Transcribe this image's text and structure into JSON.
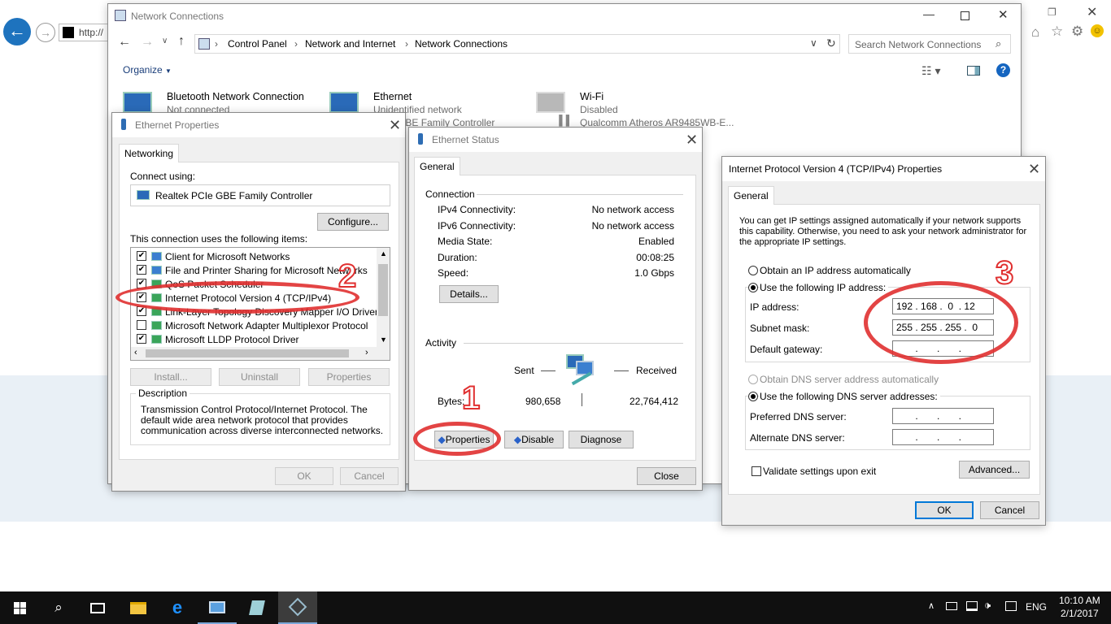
{
  "browser": {
    "url": "http://"
  },
  "netconn": {
    "title": "Network Connections",
    "breadcrumb": [
      "Control Panel",
      "Network and Internet",
      "Network Connections"
    ],
    "search_placeholder": "Search Network Connections",
    "organize": "Organize",
    "adapters": [
      {
        "name": "Bluetooth Network Connection",
        "status": "Not connected",
        "device": ""
      },
      {
        "name": "Ethernet",
        "status": "Unidentified network",
        "device": "PCIe GBE Family Controller"
      },
      {
        "name": "Wi-Fi",
        "status": "Disabled",
        "device": "Qualcomm Atheros AR9485WB-E..."
      }
    ]
  },
  "ethprops": {
    "title": "Ethernet Properties",
    "tab": "Networking",
    "connect_using": "Connect using:",
    "adapter": "Realtek PCIe GBE Family Controller",
    "configure": "Configure...",
    "items_label": "This connection uses the following items:",
    "items": [
      {
        "label": "Client for Microsoft Networks",
        "checked": true
      },
      {
        "label": "File and Printer Sharing for Microsoft Networks",
        "checked": true
      },
      {
        "label": "QoS Packet Scheduler",
        "checked": true
      },
      {
        "label": "Internet Protocol Version 4 (TCP/IPv4)",
        "checked": true
      },
      {
        "label": "Link-Layer Topology Discovery Mapper I/O Driver",
        "checked": true
      },
      {
        "label": "Microsoft Network Adapter Multiplexor Protocol",
        "checked": false
      },
      {
        "label": "Microsoft LLDP Protocol Driver",
        "checked": true
      }
    ],
    "install": "Install...",
    "uninstall": "Uninstall",
    "properties": "Properties",
    "description_label": "Description",
    "description": "Transmission Control Protocol/Internet Protocol. The default wide area network protocol that provides communication across diverse interconnected networks.",
    "ok": "OK",
    "cancel": "Cancel"
  },
  "ethstatus": {
    "title": "Ethernet Status",
    "tab": "General",
    "connection_label": "Connection",
    "rows": [
      {
        "label": "IPv4 Connectivity:",
        "value": "No network access"
      },
      {
        "label": "IPv6 Connectivity:",
        "value": "No network access"
      },
      {
        "label": "Media State:",
        "value": "Enabled"
      },
      {
        "label": "Duration:",
        "value": "00:08:25"
      },
      {
        "label": "Speed:",
        "value": "1.0 Gbps"
      }
    ],
    "details": "Details...",
    "activity_label": "Activity",
    "sent": "Sent",
    "received": "Received",
    "bytes_label": "Bytes:",
    "bytes_sent": "980,658",
    "bytes_received": "22,764,412",
    "properties": "Properties",
    "disable": "Disable",
    "diagnose": "Diagnose",
    "close": "Close"
  },
  "ipv4": {
    "title": "Internet Protocol Version 4 (TCP/IPv4) Properties",
    "tab": "General",
    "intro": "You can get IP settings assigned automatically if your network supports this capability. Otherwise, you need to ask your network administrator for the appropriate IP settings.",
    "auto_ip": "Obtain an IP address automatically",
    "manual_ip": "Use the following IP address:",
    "ip_label": "IP address:",
    "ip_value": "192 . 168 .  0  . 12",
    "mask_label": "Subnet mask:",
    "mask_value": "255 . 255 . 255 .  0",
    "gateway_label": "Default gateway:",
    "gateway_value": "       .       .       .",
    "auto_dns": "Obtain DNS server address automatically",
    "manual_dns": "Use the following DNS server addresses:",
    "pref_dns_label": "Preferred DNS server:",
    "pref_dns_value": "       .       .       .",
    "alt_dns_label": "Alternate DNS server:",
    "alt_dns_value": "       .       .       .",
    "validate": "Validate settings upon exit",
    "advanced": "Advanced...",
    "ok": "OK",
    "cancel": "Cancel"
  },
  "annotations": {
    "one": "1",
    "two": "2",
    "three": "3"
  },
  "taskbar": {
    "lang": "ENG",
    "time": "10:10 AM",
    "date": "2/1/2017"
  }
}
